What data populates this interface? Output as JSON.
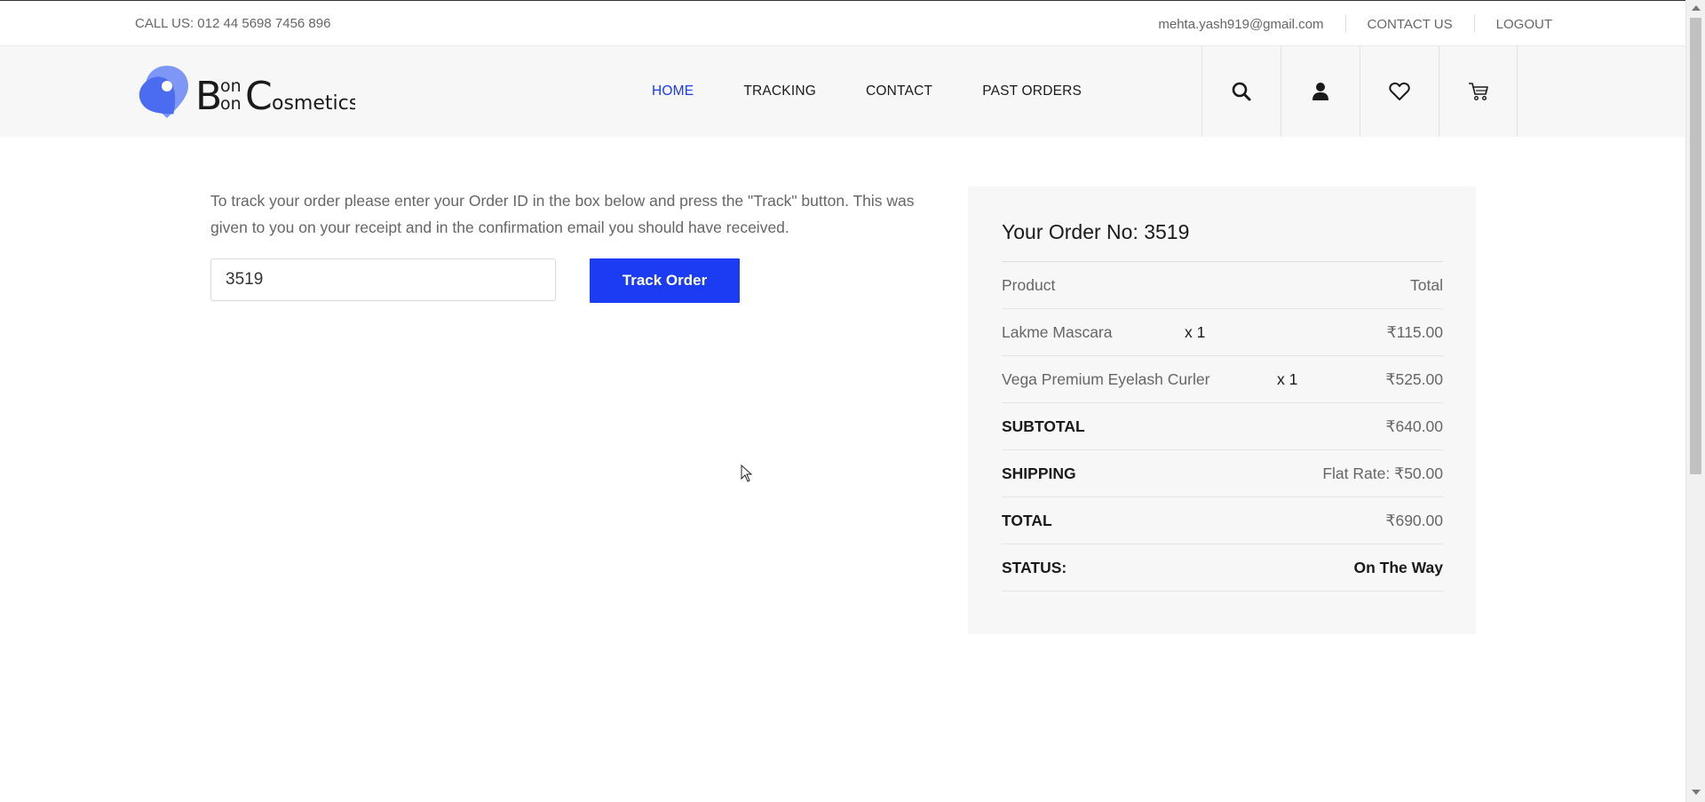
{
  "topbar": {
    "call": "CALL US: 012 44 5698 7456 896",
    "email": "mehta.yash919@gmail.com",
    "contact_us": "CONTACT US",
    "logout": "LOGOUT"
  },
  "logo": {
    "icon": "map-pin-icon",
    "text": "BonBon Cosmetics"
  },
  "nav": {
    "items": [
      {
        "label": "HOME",
        "active": true
      },
      {
        "label": "TRACKING",
        "active": false
      },
      {
        "label": "CONTACT",
        "active": false
      },
      {
        "label": "PAST ORDERS",
        "active": false
      }
    ]
  },
  "header_icons": [
    "search-icon",
    "user-icon",
    "heart-icon",
    "cart-icon"
  ],
  "main": {
    "instructions": "To track your order please enter your Order ID in the box below and press the \"Track\" button. This was given to you on your receipt and in the confirmation email you should have received.",
    "order_id_value": "3519",
    "track_button": "Track Order"
  },
  "order": {
    "title": "Your Order No: 3519",
    "header": {
      "product": "Product",
      "total": "Total"
    },
    "items": [
      {
        "name": "Lakme Mascara",
        "qty": "x 1",
        "price": "₹115.00"
      },
      {
        "name": "Vega Premium Eyelash Curler",
        "qty": "x 1",
        "price": "₹525.00"
      }
    ],
    "subtotal_label": "SUBTOTAL",
    "subtotal": "₹640.00",
    "shipping_label": "SHIPPING",
    "shipping": "Flat Rate: ₹50.00",
    "total_label": "TOTAL",
    "total": "₹690.00",
    "status_label": "STATUS:",
    "status": "On The Way"
  },
  "colors": {
    "accent": "#1b3cf2",
    "logo_blue": "#4b6cf0",
    "panel_bg": "#f7f7f7"
  }
}
